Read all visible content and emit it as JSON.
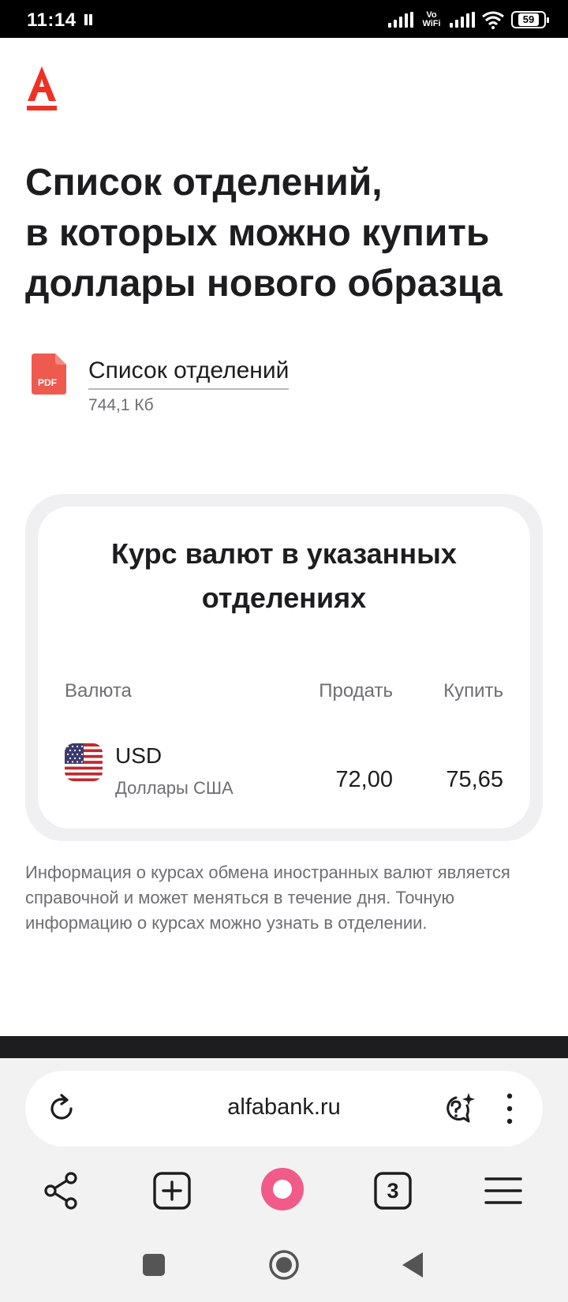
{
  "status_bar": {
    "time": "11:14",
    "network": "Vo WiFi",
    "battery": "59"
  },
  "page": {
    "logo": "logo-a-icon",
    "title_line1": "Список отделений,",
    "title_line2": "в которых можно купить",
    "title_line3": "доллары нового образца",
    "file": {
      "icon": "pdf-file-icon",
      "icon_label": "PDF",
      "name": "Список отделений",
      "size": "744,1 Кб"
    },
    "rates": {
      "title_line1": "Курс валют в указанных",
      "title_line2": "отделениях",
      "headers": {
        "currency": "Валюта",
        "sell": "Продать",
        "buy": "Купить"
      },
      "rows": [
        {
          "flag": "us-flag-icon",
          "code": "USD",
          "name": "Доллары США",
          "sell": "72,00",
          "buy": "75,65"
        }
      ]
    },
    "disclaimer": "Информация о курсах обмена иностранных валют является справочной и может меняться в течение дня. Точную информацию о курсах можно узнать в отделении."
  },
  "browser": {
    "url": "alfabank.ru",
    "tabs_count": "3"
  },
  "colors": {
    "brand_red": "#ef3124",
    "alice_pink": "#f05b8a",
    "text_primary": "#1d1d1f",
    "text_secondary": "#6e6e73"
  }
}
